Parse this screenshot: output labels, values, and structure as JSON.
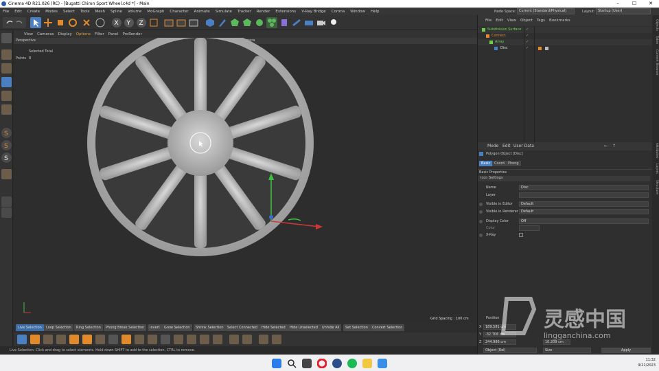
{
  "window": {
    "title": "Cinema 4D R21.026 (RC) - [Bugatti Chiron Sport Wheel.c4d *] - Main",
    "min": "–",
    "max": "☐",
    "close": "✕"
  },
  "menubar": {
    "items": [
      "File",
      "Edit",
      "Create",
      "Modes",
      "Select",
      "Tools",
      "Mesh",
      "Spline",
      "Volume",
      "MoGraph",
      "Character",
      "Animate",
      "Simulate",
      "Tracker",
      "Render",
      "Extensions",
      "V-Ray Bridge",
      "Corona",
      "Window",
      "Help"
    ],
    "node_space_label": "Node Space:",
    "node_space_value": "Current (Standard/Physical)",
    "layout_label": "Layout:",
    "layout_value": "Startup (User)"
  },
  "viewport": {
    "menu": [
      "View",
      "Cameras",
      "Display",
      "Options",
      "Filter",
      "Panel",
      "ProRender"
    ],
    "view_name": "Perspective",
    "camera": "Default Camera",
    "selected_total_label": "Selected Total",
    "points_label": "Points",
    "points_value": "8",
    "grid_spacing": "Grid Spacing : 100 cm"
  },
  "selection_bar": {
    "buttons": [
      "Live Selection",
      "Loop Selection",
      "Ring Selection",
      "Phong Break Selection",
      "Invert",
      "Grow Selection",
      "Shrink Selection",
      "Select Connected",
      "Hide Selected",
      "Hide Unselected",
      "Unhide All",
      "Set Selection",
      "Convert Selection"
    ]
  },
  "status": {
    "text": "Live Selection: Click and drag to select elements. Hold down SHIFT to add to the selection, CTRL to remove."
  },
  "object_manager": {
    "menu": [
      "File",
      "Edit",
      "View",
      "Object",
      "Tags",
      "Bookmarks"
    ],
    "rows": [
      {
        "name": "Subdivision Surface",
        "color": "#6fcf4a"
      },
      {
        "name": "Connect",
        "color": "#e08a2c"
      },
      {
        "name": "Array",
        "color": "#6fcf4a"
      },
      {
        "name": "Disc",
        "color": "#e0e0e0"
      }
    ]
  },
  "attribute_manager": {
    "menu": [
      "Mode",
      "Edit",
      "User Data"
    ],
    "object_label": "Polygon Object [Disc]",
    "tabs": [
      "Basic",
      "Coord.",
      "Phong"
    ],
    "icon_settings": "Icon Settings",
    "section": "Basic Properties",
    "name_label": "Name",
    "name_value": "Disc",
    "layer_label": "Layer",
    "visible_editor_label": "Visible in Editor",
    "visible_editor_value": "Default",
    "visible_renderer_label": "Visible in Renderer",
    "visible_renderer_value": "Default",
    "display_color_label": "Display Color",
    "display_color_value": "Off",
    "color_label": "Color",
    "xray_label": "X-Ray"
  },
  "coordinates": {
    "title": "Position",
    "x": "189.581 cm",
    "y": "-32.706 cm",
    "z": "244.986 cm",
    "size_z": "10.209 cm",
    "mode": "Object (Rel)",
    "size_mode": "Size",
    "apply": "Apply"
  },
  "right_tabs": [
    "Objects",
    "Takes",
    "Content Browser",
    "Attributes",
    "Layers",
    "Structure"
  ],
  "taskbar": {
    "time": "11:32",
    "date": "9/21/2023"
  },
  "watermark": {
    "cn": "灵感中国",
    "url": "lingganchina.com"
  },
  "colors": {
    "accent_blue": "#4a7fc1",
    "live_selection_blue": "#3d6ea8",
    "orange_icon": "#e08a2c"
  }
}
